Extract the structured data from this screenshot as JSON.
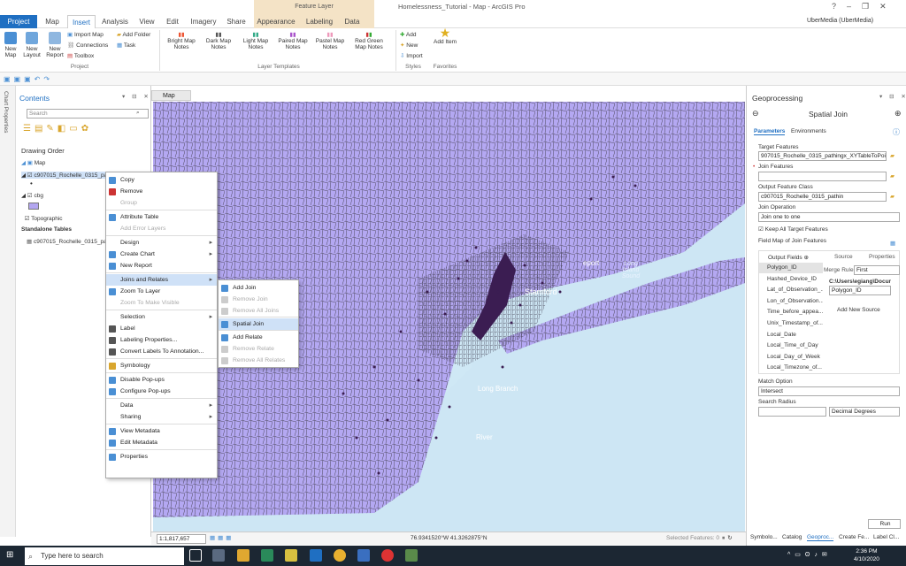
{
  "ribbon": {
    "tabs": [
      "Project",
      "Map",
      "Insert",
      "Analysis",
      "View",
      "Edit",
      "Imagery",
      "Share",
      "Appearance",
      "Labeling",
      "Data"
    ],
    "active_tab": "Insert",
    "context_group": "Feature Layer",
    "document_title": "Homelessness_Tutorial - Map - ArcGIS Pro",
    "user": "UberMedia (UberMedia)",
    "project_group": {
      "label": "Project",
      "new_map": "New Map",
      "new_layout": "New Layout",
      "new_report": "New Report",
      "import_map": "Import Map",
      "connections": "Connections",
      "toolbox": "Toolbox",
      "add_folder": "Add Folder",
      "task": "Task"
    },
    "layer_templates": {
      "label": "Layer Templates",
      "items": [
        "Bright Map Notes",
        "Dark Map Notes",
        "Light Map Notes",
        "Paired Map Notes",
        "Pastel Map Notes",
        "Red Green Map Notes"
      ]
    },
    "styles": {
      "label": "Styles",
      "add": "Add",
      "new": "New",
      "import": "Import"
    },
    "favorites": {
      "label": "Favorites",
      "add_item": "Add Item"
    }
  },
  "side_strip": {
    "label": "Chart Properties"
  },
  "contents": {
    "title": "Contents",
    "search_placeholder": "Search",
    "drawing_order": "Drawing Order",
    "map": "Map",
    "layer1": "c907015_Rochelle_0315_pathin",
    "layer2": "cbg",
    "basemap": "Topographic",
    "standalone": "Standalone Tables",
    "table1": "c907015_Rochelle_0315_pathin"
  },
  "context_menu": {
    "items": [
      {
        "label": "Copy",
        "disabled": false
      },
      {
        "label": "Remove",
        "disabled": false
      },
      {
        "label": "Group",
        "disabled": true
      },
      {
        "label": "Attribute Table",
        "disabled": false
      },
      {
        "label": "Add Error Layers",
        "disabled": true
      },
      {
        "label": "Design",
        "disabled": false,
        "sub": true
      },
      {
        "label": "Create Chart",
        "disabled": false,
        "sub": true
      },
      {
        "label": "New Report",
        "disabled": false
      },
      {
        "label": "Joins and Relates",
        "disabled": false,
        "sub": true,
        "highlight": true
      },
      {
        "label": "Zoom To Layer",
        "disabled": false
      },
      {
        "label": "Zoom To Make Visible",
        "disabled": true
      },
      {
        "label": "Selection",
        "disabled": false,
        "sub": true
      },
      {
        "label": "Label",
        "disabled": false
      },
      {
        "label": "Labeling Properties...",
        "disabled": false
      },
      {
        "label": "Convert Labels To Annotation...",
        "disabled": false
      },
      {
        "label": "Symbology",
        "disabled": false
      },
      {
        "label": "Disable Pop-ups",
        "disabled": false
      },
      {
        "label": "Configure Pop-ups",
        "disabled": false
      },
      {
        "label": "Data",
        "disabled": false,
        "sub": true
      },
      {
        "label": "Sharing",
        "disabled": false,
        "sub": true
      },
      {
        "label": "View Metadata",
        "disabled": false
      },
      {
        "label": "Edit Metadata",
        "disabled": false
      },
      {
        "label": "Properties",
        "disabled": false
      }
    ]
  },
  "submenu": {
    "items": [
      {
        "label": "Add Join",
        "disabled": false
      },
      {
        "label": "Remove Join",
        "disabled": true
      },
      {
        "label": "Remove All Joins",
        "disabled": true
      },
      {
        "label": "Spatial Join",
        "disabled": false,
        "highlight": true
      },
      {
        "label": "Add Relate",
        "disabled": false
      },
      {
        "label": "Remove Relate",
        "disabled": true
      },
      {
        "label": "Remove All Relates",
        "disabled": true
      }
    ]
  },
  "map": {
    "tab": "Map",
    "labels": [
      "Stamford",
      "Long Island Sound",
      "Long Branch",
      "River",
      "eport"
    ],
    "scale": "1:1,817,657",
    "coords": "76.9341520°W 41.3262875°N",
    "selected": "Selected Features: 0"
  },
  "geoprocessing": {
    "title": "Geoprocessing",
    "tool": "Spatial Join",
    "tab_params": "Parameters",
    "tab_env": "Environments",
    "target_label": "Target Features",
    "target_value": "907015_Rochelle_0315_pathingx_XYTableToPoint",
    "join_label": "Join Features",
    "join_value": "",
    "output_label": "Output Feature Class",
    "output_value": "c907015_Rochelle_0315_pathin",
    "operation_label": "Join Operation",
    "operation_value": "Join one to one",
    "keep_all": "Keep All Target Features",
    "field_map": "Field Map of Join Features",
    "output_fields": "Output Fields",
    "source": "Source",
    "properties": "Properties",
    "fields": [
      "Polygon_ID",
      "Hashed_Device_ID",
      "Lat_of_Observation_...",
      "Lon_of_Observation...",
      "Time_before_appea...",
      "Unix_Timestamp_of...",
      "Local_Date",
      "Local_Time_of_Day",
      "Local_Day_of_Week",
      "Local_Timezone_of..."
    ],
    "merge_rule_label": "Merge Rule",
    "merge_rule": "First",
    "source_path": "C:\\Users\\egiang\\Docur",
    "source_field": "Polygon_ID",
    "add_new_source": "Add New Source",
    "match_label": "Match Option",
    "match_value": "Intersect",
    "radius_label": "Search Radius",
    "radius_unit": "Decimal Degrees",
    "run": "Run",
    "bottom_tabs": [
      "Symbolo...",
      "Catalog",
      "Geoproc...",
      "Create Fe...",
      "Label Cl..."
    ]
  },
  "taskbar": {
    "search": "Type here to search",
    "time": "2:36 PM",
    "date": "4/10/2020"
  }
}
